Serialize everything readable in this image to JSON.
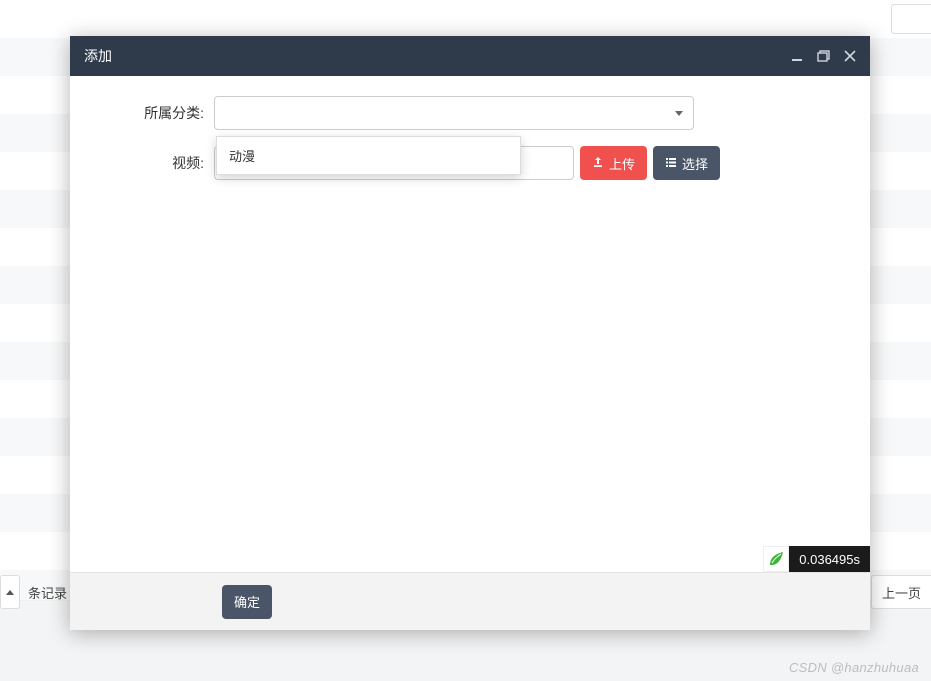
{
  "background": {
    "records_label_partial": "条记录",
    "prev_page_label": "上一页"
  },
  "modal": {
    "title": "添加",
    "form": {
      "category_label": "所属分类:",
      "category_value": "",
      "video_label": "视频:",
      "video_value": ""
    },
    "dropdown": {
      "options": [
        "动漫"
      ]
    },
    "buttons": {
      "upload": "上传",
      "choose": "选择",
      "confirm": "确定"
    },
    "icons": {
      "minimize": "minimize-icon",
      "maximize": "maximize-icon",
      "close": "close-icon",
      "upload": "upload-icon",
      "list": "list-icon",
      "profiler": "thinkphp-leaf-icon"
    },
    "profiler": {
      "time_text": "0.036495s"
    }
  },
  "watermark": "CSDN @hanzhuhuaa"
}
